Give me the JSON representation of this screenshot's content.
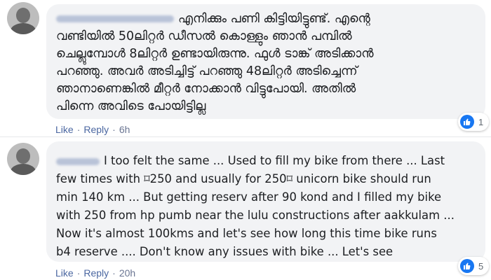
{
  "comments": [
    {
      "text": "എനിക്കും പണി കിട്ടിയിട്ടുണ്ട്. എന്റെ\nവണ്ടിയിൽ 50ലിറ്റർ ഡീസൽ കൊള്ളും ഞാൻ പമ്പിൽ\nചെല്ലുമ്പോൾ 8ലിറ്റർ ഉണ്ടായിരുന്നു. ഫുൾ ടാങ്ക് അടിക്കാൻ\nപറഞ്ഞു. അവർ അടിച്ചിട്ട് പറഞ്ഞു 48ലിറ്റർ അടിച്ചെന്ന്\nഞാനാണെങ്കിൽ മീറ്റർ നോക്കാൻ വിട്ടുപോയി. അതിൽ\nപിന്നെ അവിടെ പോയിട്ടില്ല",
      "like_label": "Like",
      "reply_label": "Reply",
      "separator": "·",
      "time": "6h",
      "reaction_count": "1",
      "reaction_icon": "thumbs-up-icon"
    },
    {
      "text": "I too felt the same ... Used to fill my bike from there ... Last\nfew times with ⌑250 and usually for 250⌑ unicorn bike should run\nmin 140 km ... But getting reserv after 90 kond and I filled my bike\nwith 250 from hp pumb near the lulu constructions after aakkulam ...\nNow it's almost 100kms and let's see how long this time bike runs\nb4 reserve .... Don't know any issues with bike ... Let's see",
      "like_label": "Like",
      "reply_label": "Reply",
      "separator": "·",
      "time": "20h",
      "reaction_count": "5",
      "reaction_icon": "thumbs-up-icon"
    }
  ],
  "colors": {
    "bubble": "#f2f3f5",
    "link": "#4b67a1",
    "like_badge": "#1877f2",
    "text": "#1c1e21"
  }
}
